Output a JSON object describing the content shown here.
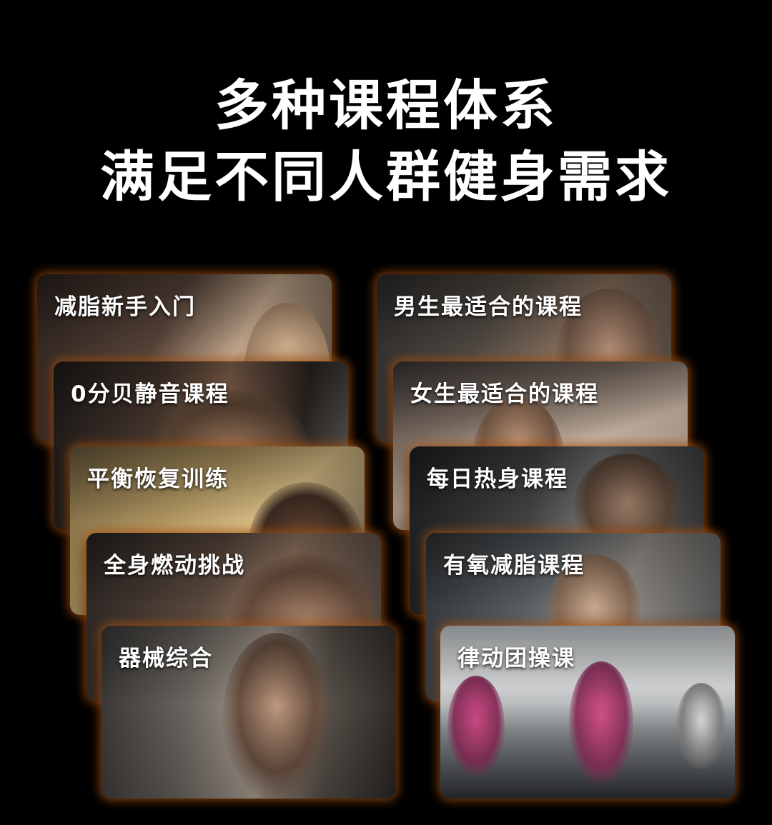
{
  "headline": {
    "line1": "多种课程体系",
    "line2": "满足不同人群健身需求"
  },
  "courses_left": [
    {
      "label": "减脂新手入门"
    },
    {
      "label": "0分贝静音课程"
    },
    {
      "label": "平衡恢复训练"
    },
    {
      "label": "全身燃动挑战"
    },
    {
      "label": "器械综合"
    }
  ],
  "courses_right": [
    {
      "label": "男生最适合的课程"
    },
    {
      "label": "女生最适合的课程"
    },
    {
      "label": "每日热身课程"
    },
    {
      "label": "有氧减脂课程"
    },
    {
      "label": "律动团操课"
    }
  ],
  "colors": {
    "background": "#000000",
    "text": "#ffffff",
    "card_glow": "#e66e14"
  }
}
